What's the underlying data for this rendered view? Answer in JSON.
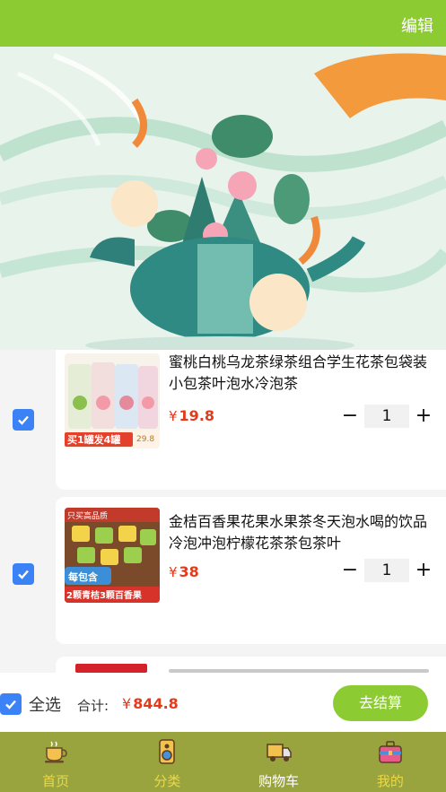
{
  "header": {
    "edit_label": "编辑"
  },
  "cart": {
    "items": [
      {
        "title": "蜜桃白桃乌龙茶绿茶组合学生花茶包袋装小包茶叶泡水冷泡茶",
        "currency": "¥",
        "price": "19.8",
        "quantity": "1",
        "checked": true,
        "thumb_promo": "买1罐发4罐",
        "thumb_price": "29.8"
      },
      {
        "title": "金桔百香果花果水果茶冬天泡水喝的饮品冷泡冲泡柠檬花茶茶包茶叶",
        "currency": "¥",
        "price": "38",
        "quantity": "1",
        "checked": true,
        "thumb_top": "只买高品质",
        "thumb_badge": "每包含",
        "thumb_promo": "2颗青桔3颗百香果"
      }
    ],
    "stepper": {
      "minus": "−",
      "plus": "+"
    }
  },
  "checkout": {
    "select_all_label": "全选",
    "total_label": "合计:",
    "currency": "¥",
    "total_value": "844.8",
    "pay_label": "去结算"
  },
  "tabbar": {
    "tabs": [
      {
        "label": "首页",
        "icon": "tea-cup-icon"
      },
      {
        "label": "分类",
        "icon": "speaker-icon"
      },
      {
        "label": "购物车",
        "icon": "truck-icon",
        "active": true
      },
      {
        "label": "我的",
        "icon": "briefcase-icon"
      }
    ]
  },
  "colors": {
    "accent": "#8dcb33",
    "price": "#e43a1c",
    "tabbar": "#9aa43e",
    "check": "#3b82f6"
  }
}
